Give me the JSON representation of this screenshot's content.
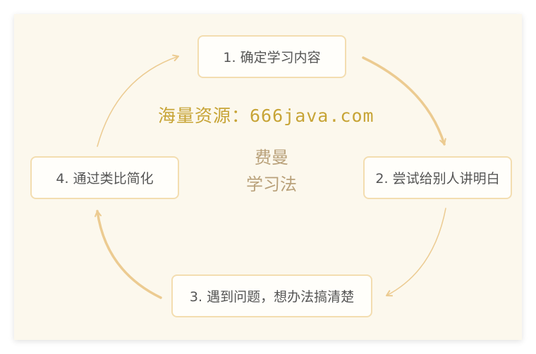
{
  "diagram": {
    "title_line1": "费曼",
    "title_line2": "学习法",
    "watermark": "海量资源：666java.com",
    "steps": [
      {
        "label": "1. 确定学习内容"
      },
      {
        "label": "2. 尝试给别人讲明白"
      },
      {
        "label": "3. 遇到问题，想办法搞清楚"
      },
      {
        "label": "4. 通过类比简化"
      }
    ]
  },
  "colors": {
    "background": "#fcf8ed",
    "box_border": "#f3ddb0",
    "arrow": "#eccb91",
    "watermark": "#c7a436",
    "title": "#b9a17a"
  }
}
